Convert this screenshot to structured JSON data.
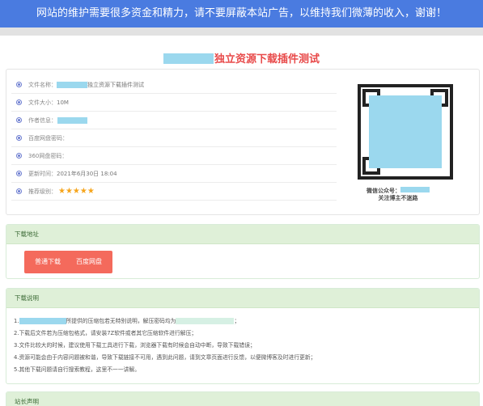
{
  "banner": {
    "text": "网站的维护需要很多资金和精力，请不要屏蔽本站广告，以维持我们微薄的收入，谢谢！"
  },
  "title": {
    "text": "独立资源下载插件测试"
  },
  "info": {
    "rows": [
      {
        "label": "文件名称：",
        "value": "独立资源下载插件测试"
      },
      {
        "label": "文件大小：",
        "value": "10M"
      },
      {
        "label": "作者信息：",
        "value": ""
      },
      {
        "label": "百度网盘密码：",
        "value": ""
      },
      {
        "label": "360网盘密码：",
        "value": ""
      },
      {
        "label": "更新时间：",
        "value": "2021年6月30日 18:04"
      },
      {
        "label": "推荐级别：",
        "value": "★★★★★"
      }
    ],
    "rating": 5
  },
  "qr": {
    "caption1": "微信公众号：",
    "caption2": "关注博主不迷路"
  },
  "download": {
    "heading": "下载地址",
    "buttons": {
      "normal": "普通下载",
      "baidu": "百度网盘"
    }
  },
  "notes": {
    "heading": "下载说明",
    "line1_prefix": "1.",
    "line1_mid": "所提供的压缩包若无特别说明，解压密码均为",
    "line1_end": "；",
    "line2": "2.下载后文件若为压缩包格式，请安装7Z软件或者其它压缩软件进行解压；",
    "line3": "3.文件比较大的时候，建议使用下载工具进行下载，浏览器下载有时候会自动中断，导致下载错误；",
    "line4": "4.资源可能会由于内容问题被和谐，导致下载链接不可用，遇到此问题，请到文章页面进行反馈，以便微博客及时进行更新；",
    "line5": "5.其他下载问题请自行搜索教程，这里不一一讲解。"
  },
  "owner": {
    "heading": "站长声明"
  },
  "colors": {
    "banner": "#4a7be0",
    "title": "#e84a4a",
    "button": "#f46a5c",
    "panel_head": "#dff0d8",
    "star": "#f6a51c",
    "redaction": "#9bd8ee"
  }
}
